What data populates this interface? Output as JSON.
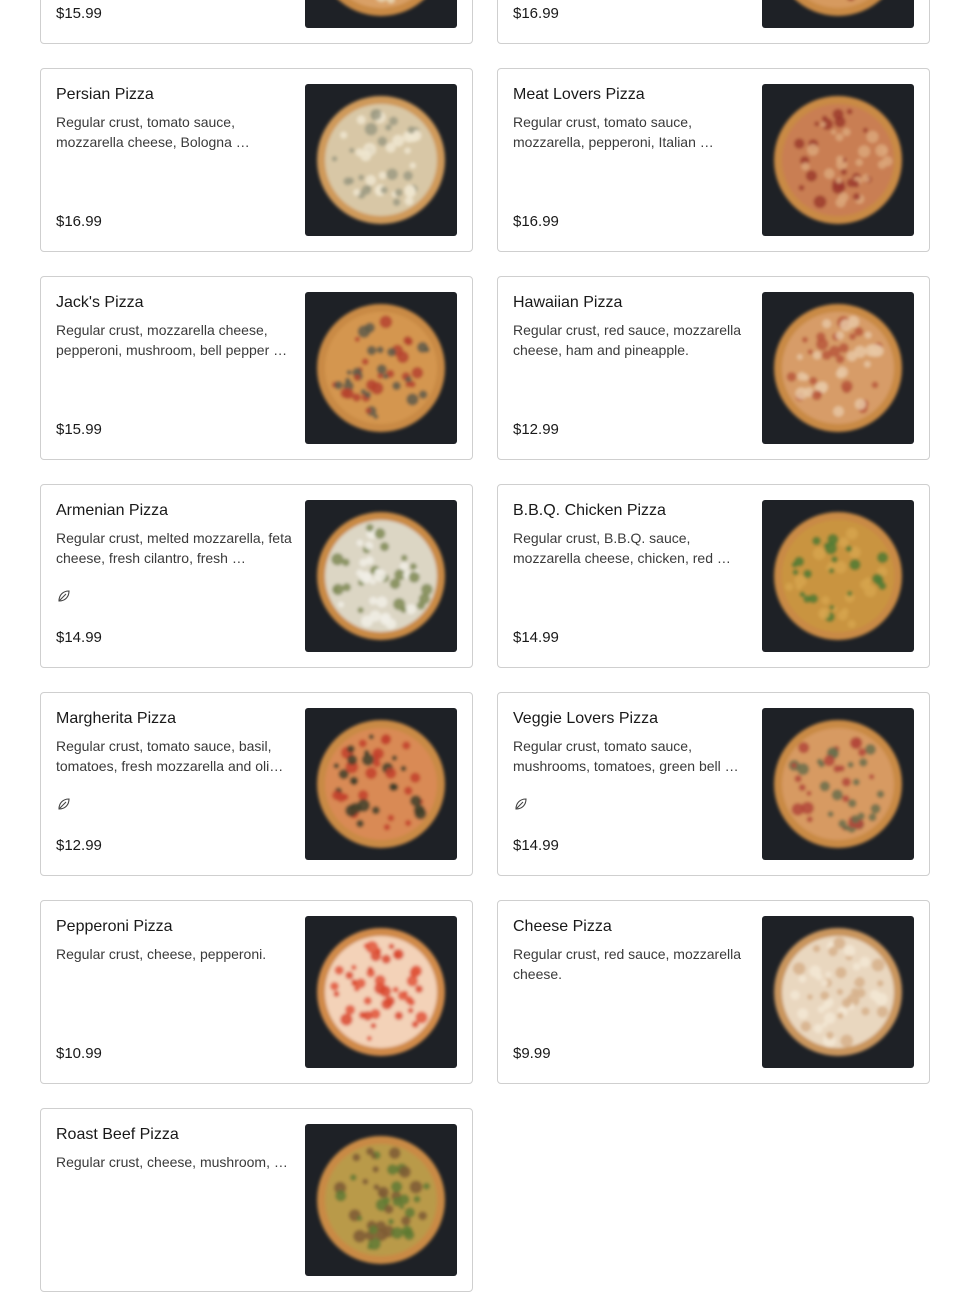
{
  "menu_items": [
    {
      "name": "",
      "description": "",
      "price": "$15.99",
      "vegetarian": false,
      "pizza_colors": {
        "crust": "#c98a45",
        "base": "#d9a066",
        "top1": "#8a3b2a",
        "top2": "#e8d9b8"
      }
    },
    {
      "name": "",
      "description": "",
      "price": "$16.99",
      "vegetarian": false,
      "pizza_colors": {
        "crust": "#c98a45",
        "base": "#d69a5e",
        "top1": "#9c3a28",
        "top2": "#e2c79a"
      }
    },
    {
      "name": "Persian Pizza",
      "description": "Regular crust, tomato sauce, mozzarella cheese, Bologna …",
      "price": "$16.99",
      "vegetarian": false,
      "pizza_colors": {
        "crust": "#cf9a5a",
        "base": "#d8c7a6",
        "top1": "#9c9a82",
        "top2": "#f0e6d0"
      }
    },
    {
      "name": "Meat Lovers Pizza",
      "description": "Regular crust, tomato sauce, mozzarella, pepperoni, Italian …",
      "price": "$16.99",
      "vegetarian": false,
      "pizza_colors": {
        "crust": "#c98a45",
        "base": "#c97e52",
        "top1": "#9c3a2e",
        "top2": "#dca77a"
      }
    },
    {
      "name": "Jack's Pizza",
      "description": "Regular crust, mozzarella cheese, pepperoni, mushroom, bell pepper …",
      "price": "$15.99",
      "vegetarian": false,
      "pizza_colors": {
        "crust": "#c98a45",
        "base": "#d4964f",
        "top1": "#5d5b4a",
        "top2": "#b5432f"
      }
    },
    {
      "name": "Hawaiian Pizza",
      "description": "Regular crust, red sauce, mozzarella cheese, ham and pineapple.",
      "price": "$12.99",
      "vegetarian": false,
      "pizza_colors": {
        "crust": "#c98a45",
        "base": "#d79c68",
        "top1": "#e8c7a3",
        "top2": "#b9583c"
      }
    },
    {
      "name": "Armenian Pizza",
      "description": "Regular crust, melted mozzarella, feta cheese, fresh cilantro, fresh …",
      "price": "$14.99",
      "vegetarian": true,
      "pizza_colors": {
        "crust": "#c98a45",
        "base": "#dcd6c4",
        "top1": "#7f8a55",
        "top2": "#f1efe6"
      }
    },
    {
      "name": "B.B.Q. Chicken Pizza",
      "description": "Regular crust, B.B.Q. sauce, mozzarella cheese, chicken, red …",
      "price": "$14.99",
      "vegetarian": false,
      "pizza_colors": {
        "crust": "#c98a45",
        "base": "#c99440",
        "top1": "#4f7a35",
        "top2": "#d6a54e"
      }
    },
    {
      "name": "Margherita Pizza",
      "description": "Regular crust, tomato sauce, basil, tomatoes, fresh mozzarella and oli…",
      "price": "$12.99",
      "vegetarian": true,
      "pizza_colors": {
        "crust": "#c98a45",
        "base": "#d98a55",
        "top1": "#c2412d",
        "top2": "#3e3f2c"
      }
    },
    {
      "name": "Veggie Lovers Pizza",
      "description": "Regular crust, tomato sauce, mushrooms, tomatoes, green bell …",
      "price": "$14.99",
      "vegetarian": true,
      "pizza_colors": {
        "crust": "#c98a45",
        "base": "#d79a62",
        "top1": "#6a6f4c",
        "top2": "#b3463a"
      }
    },
    {
      "name": "Pepperoni Pizza",
      "description": "Regular crust, cheese, pepperoni.",
      "price": "$10.99",
      "vegetarian": false,
      "pizza_colors": {
        "crust": "#d08a48",
        "base": "#f3d2b8",
        "top1": "#d9492f",
        "top2": "#e0563a"
      }
    },
    {
      "name": "Cheese Pizza",
      "description": "Regular crust, red sauce, mozzarella cheese.",
      "price": "$9.99",
      "vegetarian": false,
      "pizza_colors": {
        "crust": "#c9955d",
        "base": "#e9d7bf",
        "top1": "#d6b08a",
        "top2": "#f3e7d4"
      }
    },
    {
      "name": "Roast Beef Pizza",
      "description": "Regular crust, cheese, mushroom, …",
      "price": "",
      "vegetarian": false,
      "pizza_colors": {
        "crust": "#c98a45",
        "base": "#b99a4a",
        "top1": "#5f7a34",
        "top2": "#7c5a34"
      }
    }
  ],
  "colors": {
    "card_border": "#cfcfcf",
    "photo_bg": "#1e2126",
    "text": "#191919"
  },
  "icons": {
    "vegetarian": "leaf-icon"
  }
}
